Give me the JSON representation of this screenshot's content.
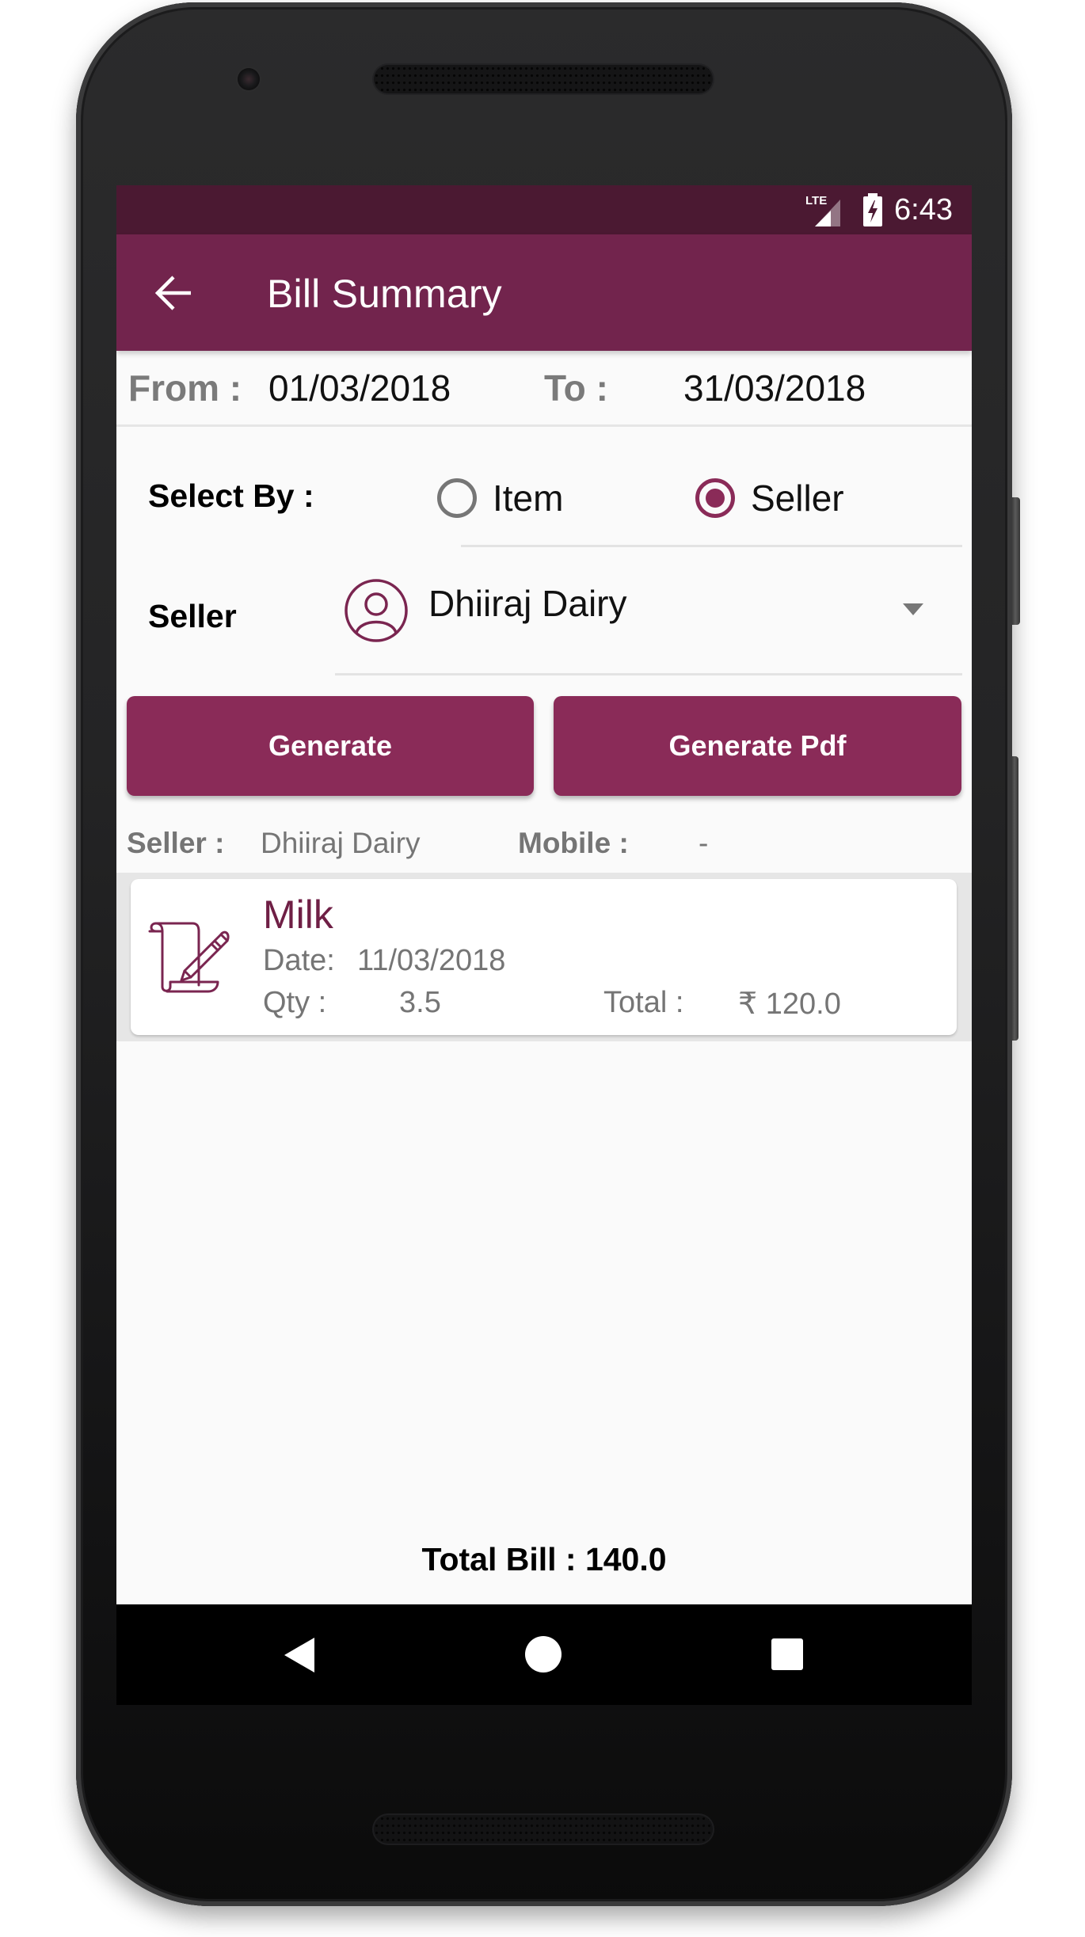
{
  "status_bar": {
    "network": "LTE",
    "time": "6:43",
    "icons": [
      "lte-signal-icon",
      "battery-charging-icon"
    ]
  },
  "app_bar": {
    "title": "Bill Summary",
    "back_icon": "arrow-back-icon"
  },
  "date_range": {
    "from_label": "From :",
    "from_value": "01/03/2018",
    "to_label": "To :",
    "to_value": "31/03/2018"
  },
  "select_by": {
    "label": "Select By :",
    "options": [
      {
        "label": "Item",
        "checked": false
      },
      {
        "label": "Seller",
        "checked": true
      }
    ]
  },
  "seller_select": {
    "label": "Seller",
    "value": "Dhiiraj Dairy",
    "icon": "person-circle-icon"
  },
  "buttons": {
    "generate": "Generate",
    "generate_pdf": "Generate Pdf"
  },
  "seller_info": {
    "seller_label": "Seller :",
    "seller_value": "Dhiiraj Dairy",
    "mobile_label": "Mobile :",
    "mobile_value": "-"
  },
  "bills": [
    {
      "item": "Milk",
      "date_label": "Date:",
      "date": "11/03/2018",
      "qty_label": "Qty :",
      "qty": "3.5",
      "total_label": "Total :",
      "total": "₹ 120.0",
      "icon": "scroll-pencil-icon"
    }
  ],
  "total_bill": "Total Bill : 140.0",
  "colors": {
    "status_bar": "#4b1932",
    "app_bar": "#72244d",
    "accent": "#8a2b58",
    "item_title": "#6f1f45"
  }
}
